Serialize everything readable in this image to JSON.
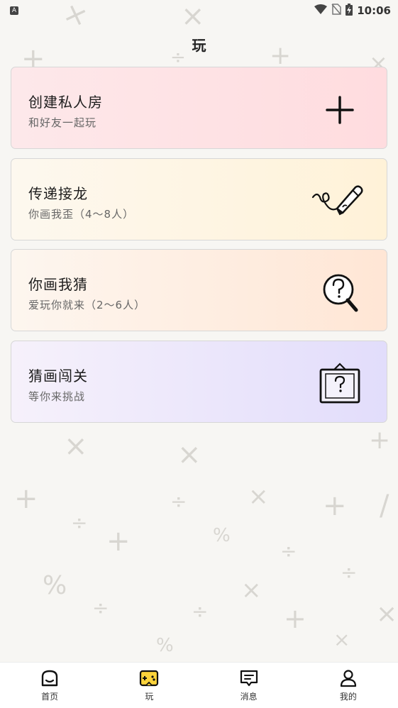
{
  "status_bar": {
    "notification_badge": "A",
    "time": "10:06"
  },
  "header": {
    "title": "玩"
  },
  "cards": [
    {
      "title": "创建私人房",
      "subtitle": "和好友一起玩",
      "icon": "plus-icon"
    },
    {
      "title": "传递接龙",
      "subtitle": "你画我歪（4～8人）",
      "icon": "pencil-icon"
    },
    {
      "title": "你画我猜",
      "subtitle": "爱玩你就来（2～6人）",
      "icon": "magnifier-question-icon"
    },
    {
      "title": "猜画闯关",
      "subtitle": "等你来挑战",
      "icon": "picture-frame-question-icon"
    }
  ],
  "bottom_nav": [
    {
      "label": "首页",
      "icon": "home-icon"
    },
    {
      "label": "玩",
      "icon": "gamepad-icon",
      "active": true
    },
    {
      "label": "消息",
      "icon": "message-icon"
    },
    {
      "label": "我的",
      "icon": "user-icon"
    }
  ],
  "colors": {
    "active_nav": "#fbd33b",
    "card_border": "#d7d7d7"
  }
}
